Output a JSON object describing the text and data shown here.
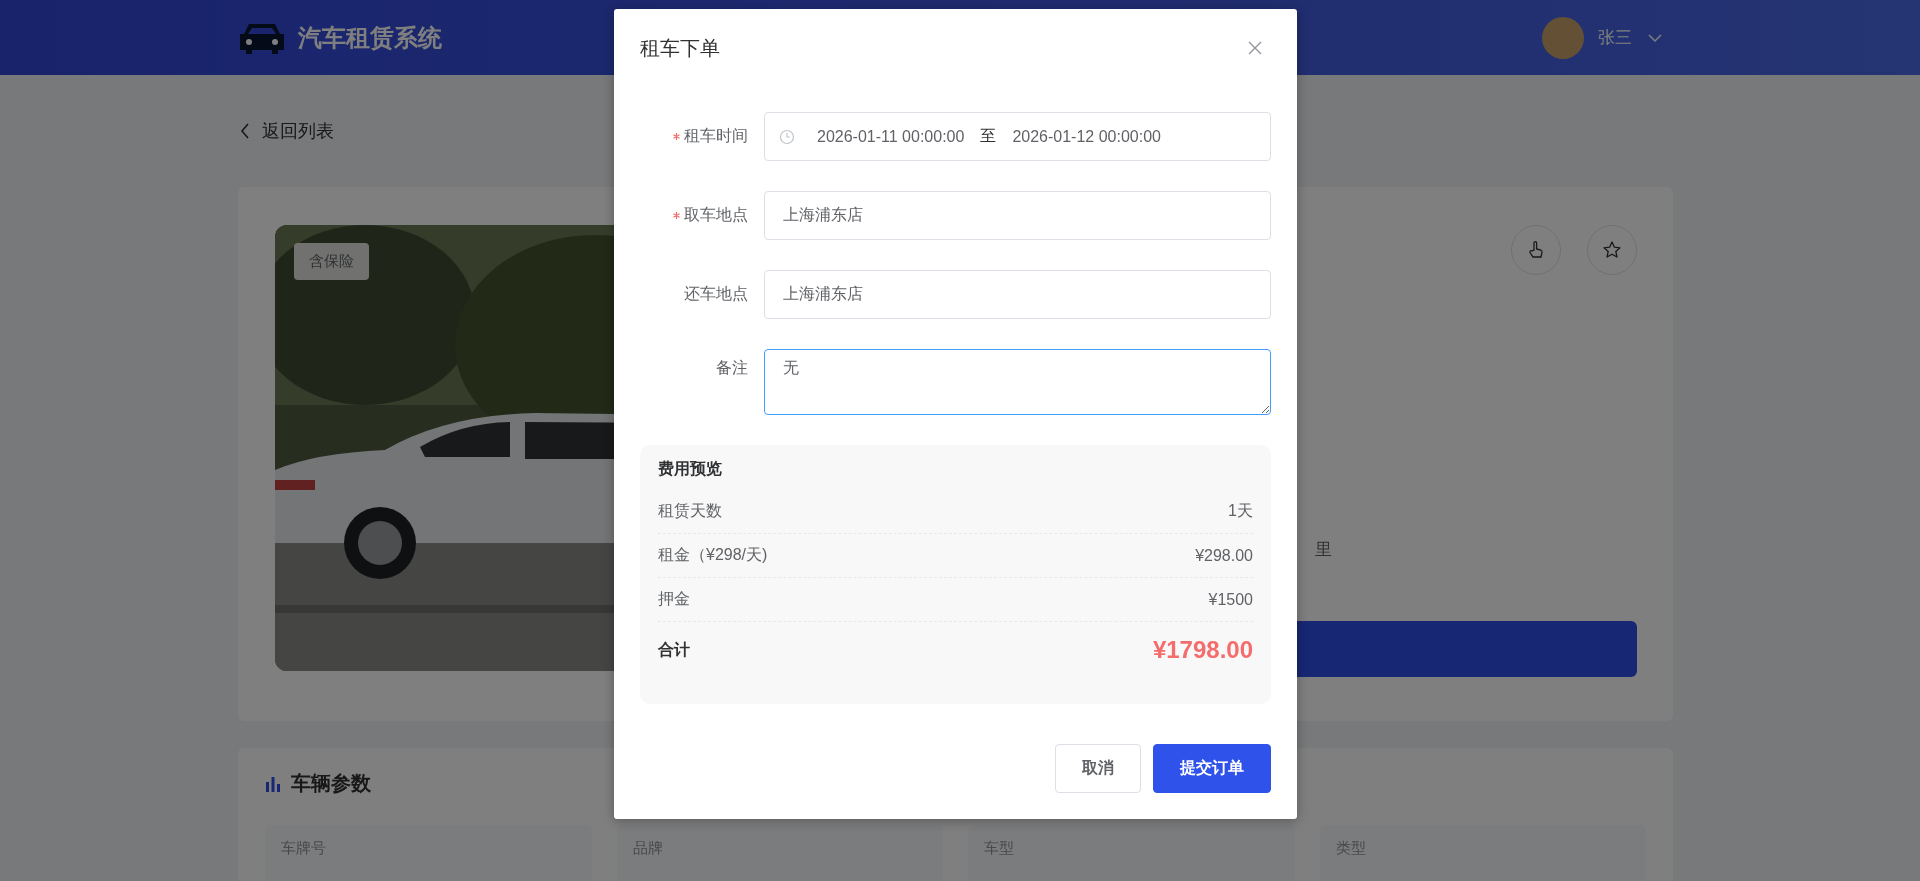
{
  "header": {
    "title": "汽车租赁系统",
    "user": "张三"
  },
  "back_link": "返回列表",
  "car_card": {
    "badge": "含保险",
    "text_fragment": "里"
  },
  "params": {
    "title": "车辆参数",
    "items": [
      {
        "label": "车牌号"
      },
      {
        "label": "品牌"
      },
      {
        "label": "车型"
      },
      {
        "label": "类型"
      }
    ]
  },
  "modal": {
    "title": "租车下单",
    "fields": [
      {
        "kind": "daterange",
        "label": "租车时间",
        "required": true,
        "focused": false,
        "start": "2026-01-11 00:00:00",
        "separator": "至",
        "end": "2026-01-12 00:00:00"
      },
      {
        "kind": "input",
        "label": "取车地点",
        "required": true,
        "focused": false,
        "value": "上海浦东店"
      },
      {
        "kind": "input",
        "label": "还车地点",
        "required": false,
        "focused": false,
        "value": "上海浦东店"
      },
      {
        "kind": "textarea",
        "label": "备注",
        "required": false,
        "focused": true,
        "value": "无"
      }
    ],
    "fee": {
      "title": "费用预览",
      "rows": [
        {
          "label": "租赁天数",
          "value": "1天"
        },
        {
          "label": "租金（¥298/天)",
          "value": "¥298.00"
        },
        {
          "label": "押金",
          "value": "¥1500"
        }
      ],
      "total": {
        "label": "合计",
        "value": "¥1798.00"
      }
    },
    "buttons": [
      {
        "label": "取消",
        "kind": "default"
      },
      {
        "label": "提交订单",
        "kind": "primary"
      }
    ]
  }
}
